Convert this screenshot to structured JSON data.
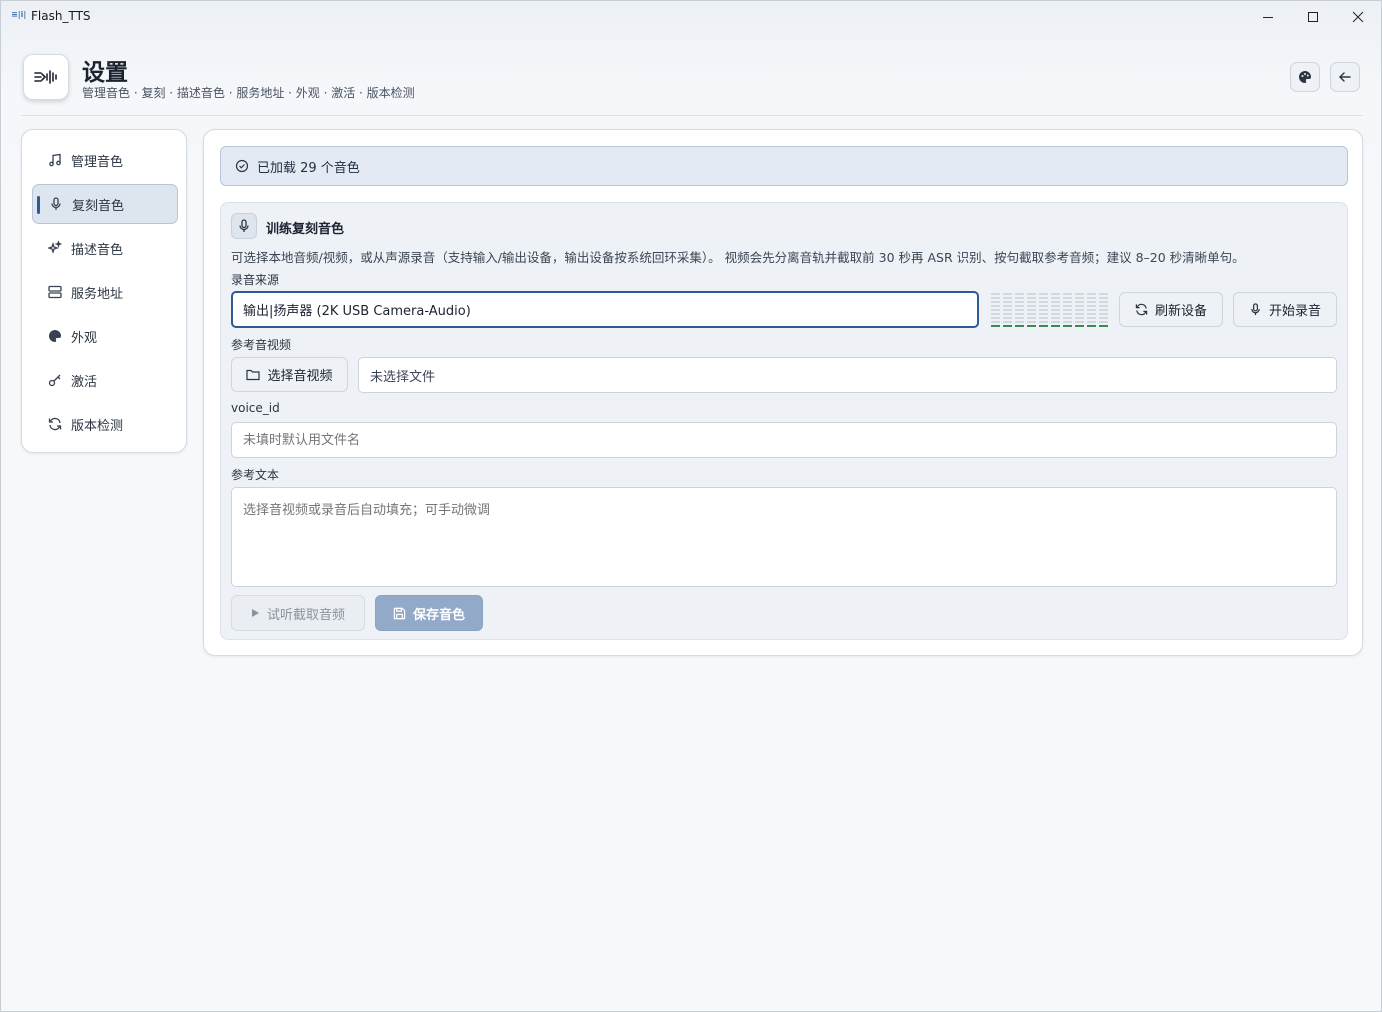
{
  "window": {
    "title": "Flash_TTS",
    "icon_text": "≡|i|"
  },
  "header": {
    "title": "设置",
    "subtitle": "管理音色 · 复刻 · 描述音色 · 服务地址 · 外观 · 激活 · 版本检测"
  },
  "sidebar": {
    "items": [
      {
        "label": "管理音色",
        "icon": "music-note-icon"
      },
      {
        "label": "复刻音色",
        "icon": "microphone-icon",
        "active": true
      },
      {
        "label": "描述音色",
        "icon": "sparkles-icon"
      },
      {
        "label": "服务地址",
        "icon": "server-icon"
      },
      {
        "label": "外观",
        "icon": "palette-icon"
      },
      {
        "label": "激活",
        "icon": "key-icon"
      },
      {
        "label": "版本检测",
        "icon": "refresh-icon"
      }
    ]
  },
  "status": {
    "text": "已加载 29 个音色"
  },
  "clone_card": {
    "title": "训练复刻音色",
    "description": "可选择本地音频/视频，或从声源录音（支持输入/输出设备，输出设备按系统回环采集）。 视频会先分离音轨并截取前 30 秒再 ASR 识别、按句截取参考音频；建议 8–20 秒清晰单句。",
    "source_label": "录音来源",
    "source_value": "输出|扬声器 (2K USB Camera-Audio)",
    "refresh_button": "刷新设备",
    "record_button": "开始录音",
    "ref_media_label": "参考音视频",
    "choose_button": "选择音视频",
    "file_value": "未选择文件",
    "voice_id_label": "voice_id",
    "voice_id_placeholder": "未填时默认用文件名",
    "ref_text_label": "参考文本",
    "ref_text_placeholder": "选择音视频或录音后自动填充；可手动微调",
    "preview_button": "试听截取音频",
    "save_button": "保存音色"
  },
  "colors": {
    "accent": "#2f5a93",
    "meter_green": "#3d8a4a",
    "primary_disabled": "#92a9ca"
  }
}
